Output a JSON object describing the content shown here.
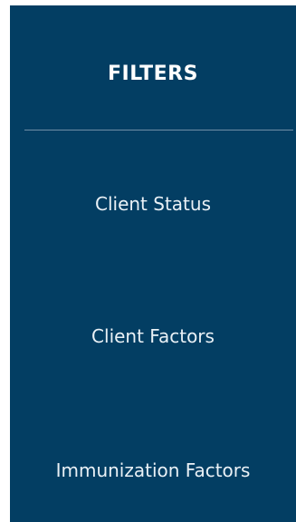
{
  "panel": {
    "title": "FILTERS",
    "background": "#033e63",
    "items": [
      {
        "label": "Client Status"
      },
      {
        "label": "Client Factors"
      },
      {
        "label": "Immunization Factors"
      }
    ]
  }
}
